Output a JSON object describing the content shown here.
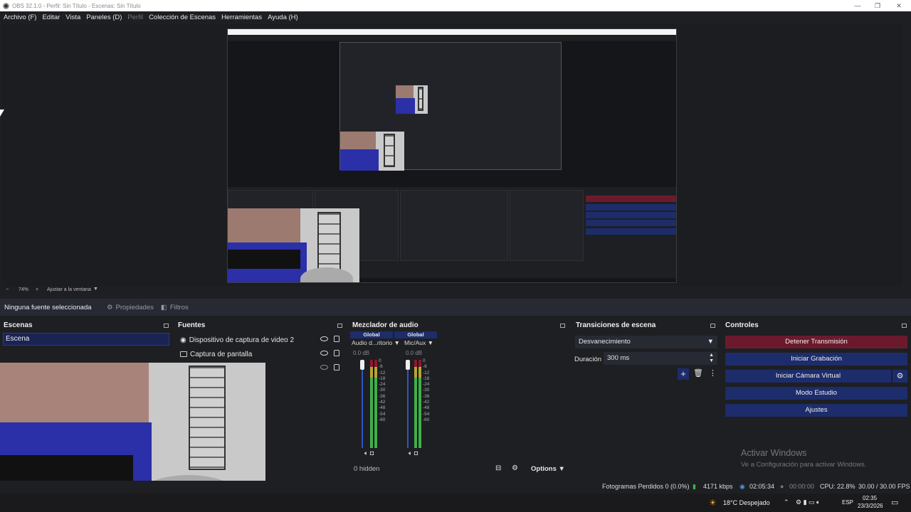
{
  "window": {
    "title": "OBS 32.1.0 - Perfil: Sin Título - Escenas: Sin Título"
  },
  "menu": [
    {
      "label": "Archivo (F)",
      "dim": false
    },
    {
      "label": "Editar",
      "dim": false
    },
    {
      "label": "Vista",
      "dim": false
    },
    {
      "label": "Paneles (D)",
      "dim": false
    },
    {
      "label": "Perfil",
      "dim": true
    },
    {
      "label": "Colección de Escenas",
      "dim": false
    },
    {
      "label": "Herramientas",
      "dim": false
    },
    {
      "label": "Ayuda (H)",
      "dim": false
    }
  ],
  "zoom": {
    "value": "74%",
    "fit": "Ajustar a la ventana"
  },
  "sourcebar": {
    "selection": "Ninguna fuente seleccionada",
    "properties": "Propiedades",
    "filters": "Filtros"
  },
  "scenes": {
    "title": "Escenas",
    "items": [
      "Escena"
    ]
  },
  "sources": {
    "title": "Fuentes",
    "items": [
      "Dispositivo de captura de video 2",
      "Captura de pantalla"
    ]
  },
  "mixer": {
    "title": "Mezclador de audio",
    "channels": [
      {
        "global": "Global",
        "name": "Audio d...ritorio",
        "db": "0.0 dB"
      },
      {
        "global": "Global",
        "name": "Mic/Aux",
        "db": "0.0 dB"
      }
    ],
    "ticks": [
      "0",
      "-6",
      "-12",
      "-18",
      "-24",
      "-30",
      "-36",
      "-42",
      "-48",
      "-54",
      "-60"
    ],
    "hidden": "0 hidden",
    "options": "Options"
  },
  "transitions": {
    "title": "Transiciones de escena",
    "type": "Desvanecimiento",
    "duration_label": "Duración",
    "duration": "300 ms"
  },
  "controls": {
    "title": "Controles",
    "stop_stream": "Detener Transmisión",
    "start_record": "Iniciar Grabación",
    "virtual_cam": "Iniciar Cámara Virtual",
    "studio": "Modo Estudio",
    "settings": "Ajustes"
  },
  "activate": {
    "title": "Activar Windows",
    "subtitle": "Ve a Configuración para activar Windows."
  },
  "status": {
    "dropped": "Fotogramas Perdidos 0 (0.0%)",
    "bitrate": "4171 kbps",
    "stream_time": "02:05:34",
    "rec_time": "00:00:00",
    "cpu": "CPU: 22.8%",
    "fps": "30.00 / 30.00 FPS"
  },
  "taskbar": {
    "weather": "18°C  Despejado",
    "lang": "ESP",
    "time": "02:35",
    "date": "23/3/2026"
  },
  "colors": {
    "blue_button": "#1d2c6b",
    "red_button": "#6b1a2d",
    "background": "#1e1f22"
  }
}
